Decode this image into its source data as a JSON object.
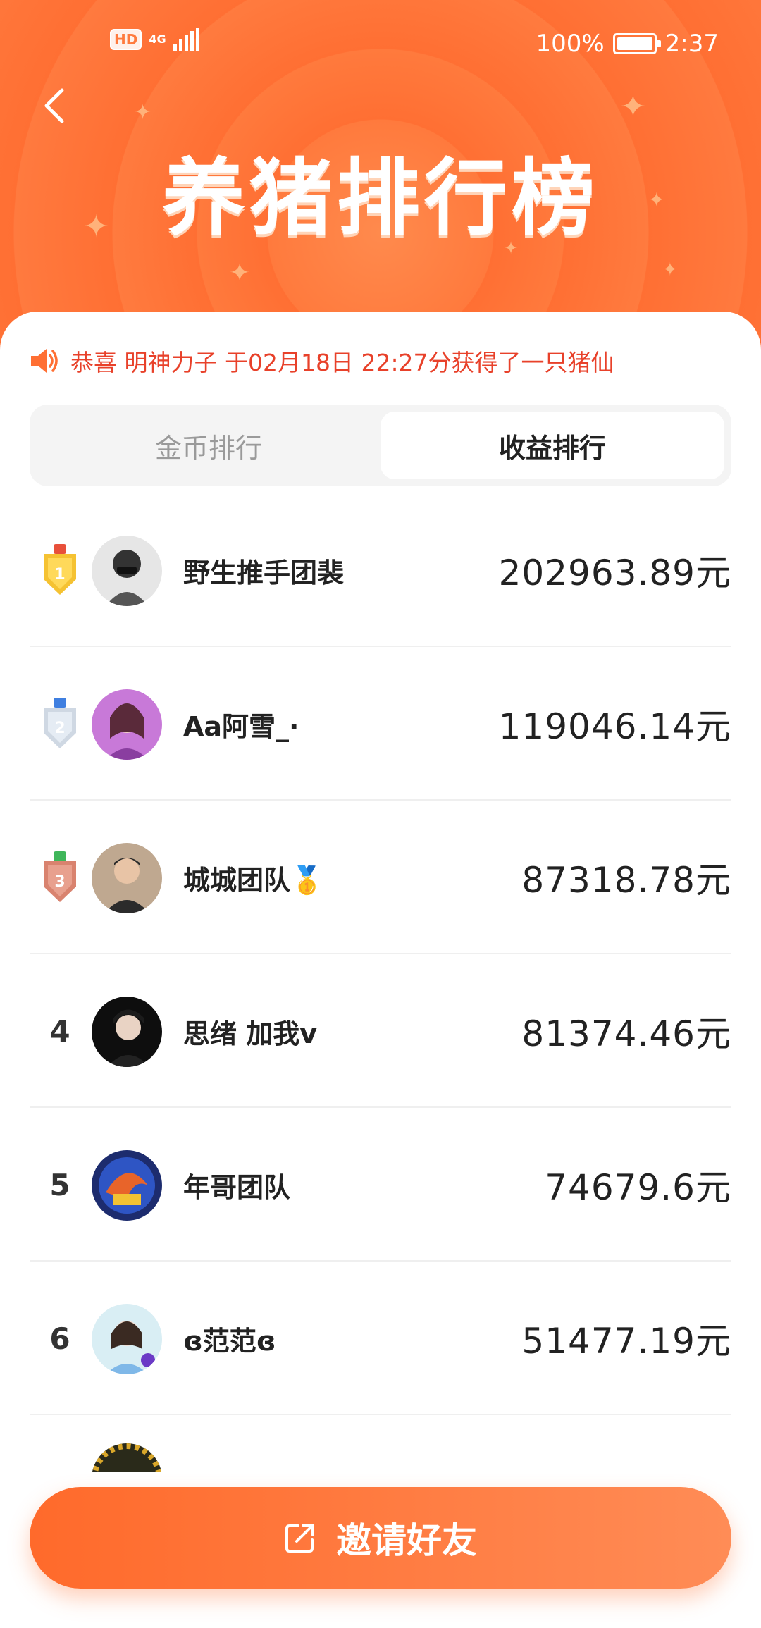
{
  "status_bar": {
    "hd": "HD",
    "network": "4G",
    "battery_text": "100%",
    "time": "2:37"
  },
  "header": {
    "title": "养猪排行榜",
    "back_icon": "chevron-left-icon"
  },
  "notice": {
    "icon": "speaker-icon",
    "text": "恭喜 明神力子 于02月18日 22:27分获得了一只猪仙"
  },
  "tabs": [
    {
      "label": "金币排行",
      "active": false
    },
    {
      "label": "收益排行",
      "active": true
    }
  ],
  "ranking": [
    {
      "rank": "1",
      "name": "野生推手团裴",
      "amount": "202963.89元"
    },
    {
      "rank": "2",
      "name": "Aa阿雪_·",
      "amount": "119046.14元"
    },
    {
      "rank": "3",
      "name": "城城团队🥇",
      "amount": "87318.78元"
    },
    {
      "rank": "4",
      "name": "思绪 加我v",
      "amount": "81374.46元"
    },
    {
      "rank": "5",
      "name": "年哥团队",
      "amount": "74679.6元"
    },
    {
      "rank": "6",
      "name": "ɞ范范ɞ",
      "amount": "51477.19元"
    }
  ],
  "invite_button": {
    "label": "邀请好友",
    "icon": "share-icon"
  },
  "colors": {
    "brand_orange": "#ff6f33",
    "notice_red": "#e8412a",
    "gold": "#f5c232",
    "silver": "#cfd8e3",
    "bronze": "#d9836f"
  }
}
